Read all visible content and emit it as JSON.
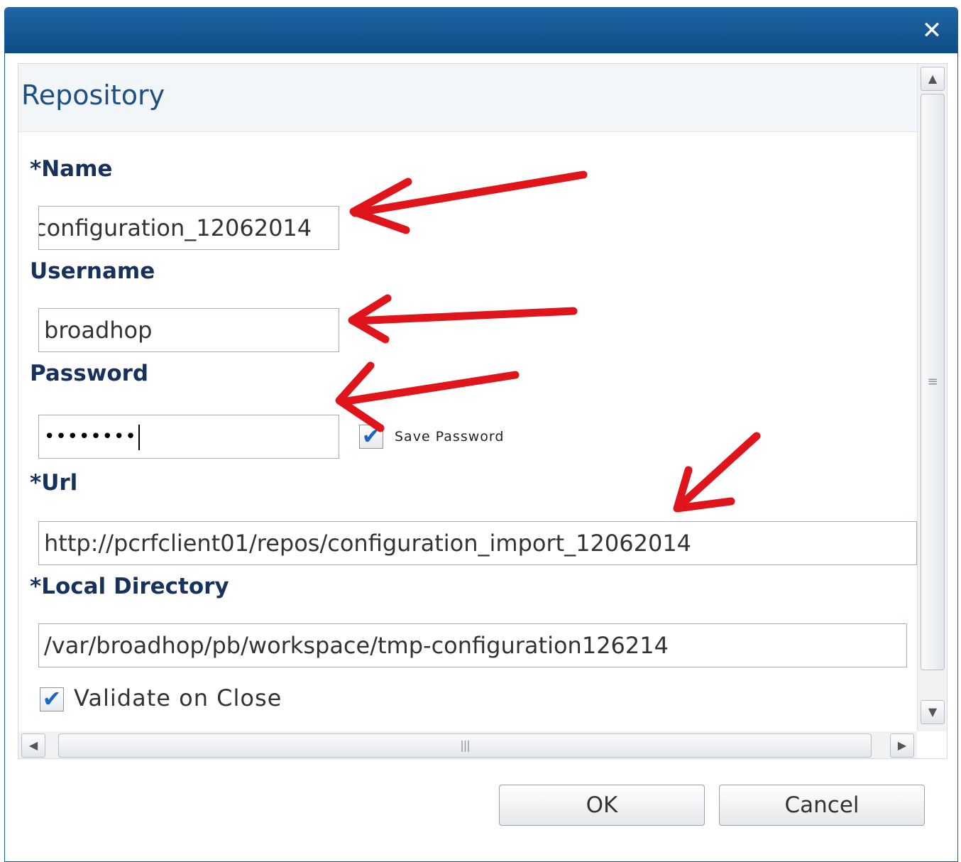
{
  "dialog": {
    "close_glyph": "✕",
    "title": "Repository"
  },
  "form": {
    "name": {
      "label": "*Name",
      "value": "configuration_12062014"
    },
    "username": {
      "label": "Username",
      "value": "broadhop"
    },
    "password": {
      "label": "Password",
      "masked_value": "••••••••",
      "save_label": "Save Password",
      "save_checked": true
    },
    "url": {
      "label": "*Url",
      "value": "http://pcrfclient01/repos/configuration_import_12062014"
    },
    "local_directory": {
      "label": "*Local Directory",
      "value": "/var/broadhop/pb/workspace/tmp-configuration126214"
    },
    "validate": {
      "label": "Validate on Close",
      "checked": true
    }
  },
  "scrollbars": {
    "up_glyph": "▲",
    "down_glyph": "▼",
    "left_glyph": "◀",
    "right_glyph": "▶",
    "v_grip": "≡",
    "h_grip": "|||"
  },
  "buttons": {
    "ok": "OK",
    "cancel": "Cancel"
  },
  "colors": {
    "titlebar": "#1e66a5",
    "title_text": "#1e4f84",
    "label_text": "#16325c",
    "annotation": "#e0141b"
  },
  "check_glyph": "✔"
}
